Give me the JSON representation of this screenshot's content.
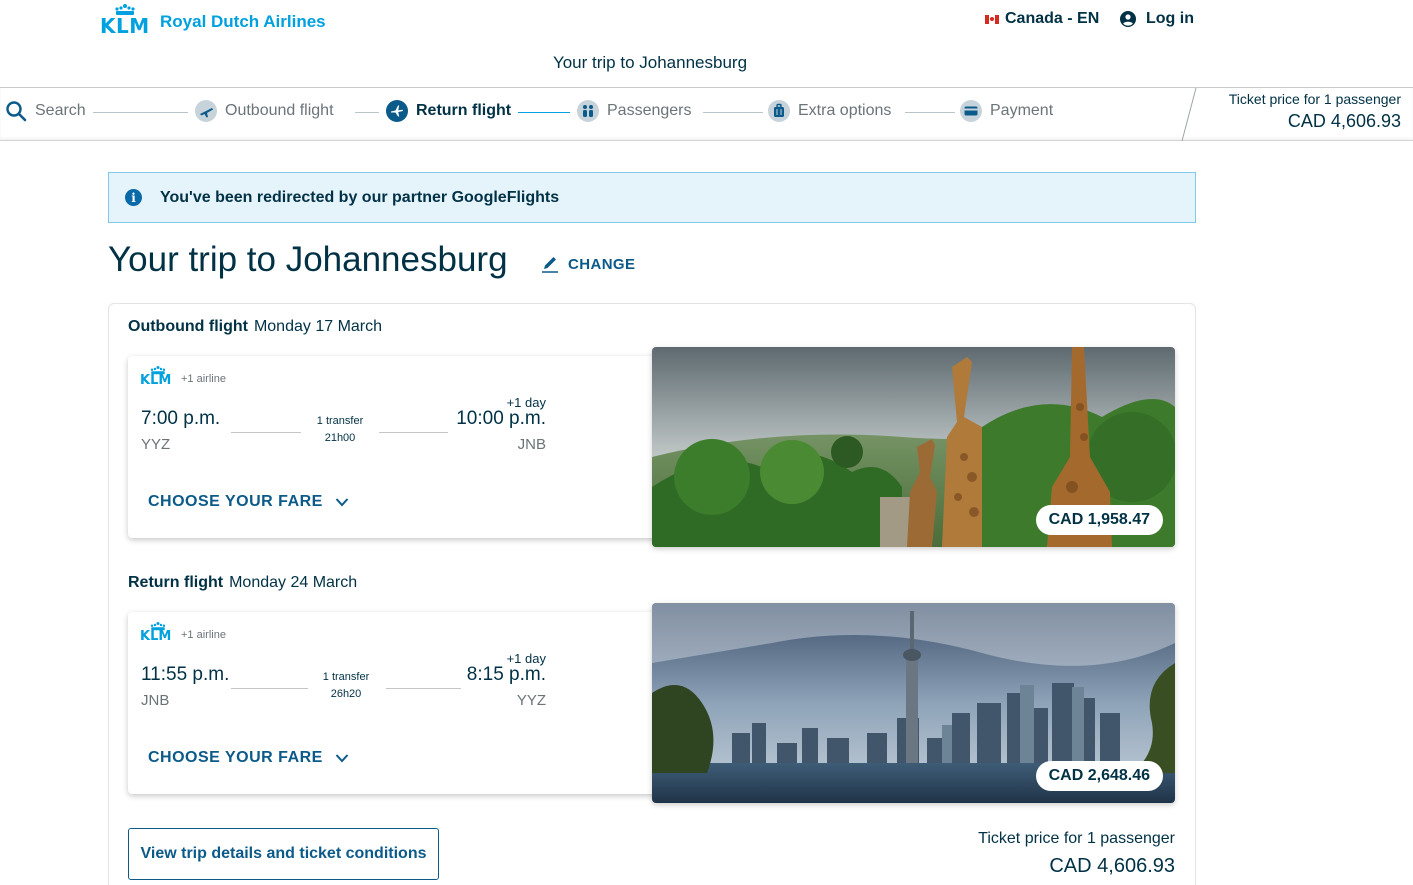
{
  "header": {
    "brand": "KLM",
    "airline_name": "Royal Dutch Airlines",
    "locale": "Canada - EN",
    "login": "Log in",
    "title": "Your trip to Johannesburg"
  },
  "stepper": {
    "steps": [
      {
        "label": "Search",
        "icon": "search-icon"
      },
      {
        "label": "Outbound flight",
        "icon": "plane-takeoff-icon"
      },
      {
        "label": "Return flight",
        "icon": "plane-icon",
        "active": true
      },
      {
        "label": "Passengers",
        "icon": "passengers-icon"
      },
      {
        "label": "Extra options",
        "icon": "luggage-icon"
      },
      {
        "label": "Payment",
        "icon": "credit-card-icon"
      }
    ],
    "price_label": "Ticket price for 1 passenger",
    "price_value": "CAD 4,606.93"
  },
  "banner": {
    "icon": "info-icon",
    "text": "You've been redirected by our partner GoogleFlights"
  },
  "trip": {
    "title": "Your trip to Johannesburg",
    "change_label": "CHANGE"
  },
  "outbound": {
    "label": "Outbound flight",
    "date": "Monday 17 March",
    "brand": "KLM",
    "extra_airline": "+1 airline",
    "dep_time": "7:00 p.m.",
    "dep_code": "YYZ",
    "transfer": "1 transfer",
    "duration": "21h00",
    "plus_day": "+1 day",
    "arr_time": "10:00 p.m.",
    "arr_code": "JNB",
    "choose": "CHOOSE YOUR FARE",
    "price": "CAD 1,958.47"
  },
  "return": {
    "label": "Return flight",
    "date": "Monday 24 March",
    "brand": "KLM",
    "extra_airline": "+1 airline",
    "dep_time": "11:55 p.m.",
    "dep_code": "JNB",
    "transfer": "1 transfer",
    "duration": "26h20",
    "plus_day": "+1 day",
    "arr_time": "8:15 p.m.",
    "arr_code": "YYZ",
    "choose": "CHOOSE YOUR FARE",
    "price": "CAD 2,648.46"
  },
  "footer": {
    "details_button": "View trip details and ticket conditions",
    "price_label": "Ticket price for 1 passenger",
    "price_value": "CAD 4,606.93"
  },
  "colors": {
    "brand_blue": "#00a1de",
    "navy": "#003145",
    "link": "#0b5a8a",
    "banner_bg": "#e5f3fb"
  }
}
